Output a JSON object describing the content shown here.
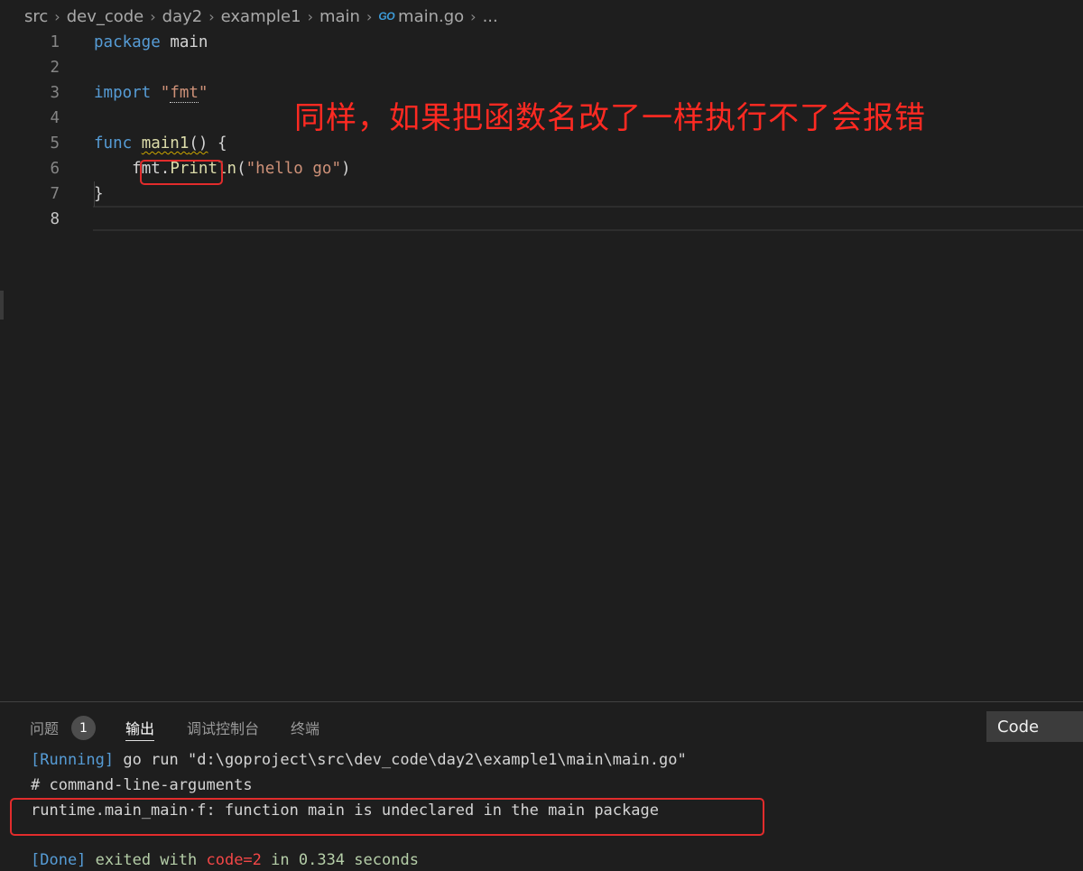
{
  "breadcrumb": {
    "items": [
      "src",
      "dev_code",
      "day2",
      "example1",
      "main"
    ],
    "file_icon": "go-icon",
    "file_icon_text": "GO",
    "file": "main.go",
    "trailing": "...",
    "separator": "›"
  },
  "editor": {
    "line_numbers": [
      "1",
      "2",
      "3",
      "4",
      "5",
      "6",
      "7",
      "8"
    ],
    "line1": {
      "kw": "package",
      "name": "main"
    },
    "line3": {
      "kw": "import",
      "q1": "\"",
      "pkg": "fmt",
      "q2": "\""
    },
    "line5": {
      "kw": "func",
      "name": "main1",
      "parens": "()",
      "brace": " {"
    },
    "line6": {
      "indent": "    ",
      "obj": "fmt",
      "dot": ".",
      "method": "Println",
      "open": "(",
      "str": "\"hello go\"",
      "close": ")"
    },
    "line7": {
      "brace": "}"
    }
  },
  "annotation": {
    "text": "同样，如果把函数名改了一样执行不了会报错",
    "color": "#ff2a22"
  },
  "panel": {
    "tabs": [
      {
        "label": "问题"
      },
      {
        "label": "输出"
      },
      {
        "label": "调试控制台"
      },
      {
        "label": "终端"
      }
    ],
    "problems_count": "1",
    "active_tab": "输出",
    "channel": "Code",
    "output": {
      "running_tag": "[Running]",
      "running_cmd": " go run \"d:\\goproject\\src\\dev_code\\day2\\example1\\main\\main.go\"",
      "line2": "# command-line-arguments",
      "line3": "runtime.main_main·f: function main is undeclared in the main package",
      "done_tag": "[Done]",
      "done_a": " exited with ",
      "done_code": "code=2",
      "done_b": " in ",
      "done_time": "0.334",
      "done_c": " seconds"
    }
  },
  "colors": {
    "keyword": "#569cd6",
    "string": "#ce9178",
    "function": "#dcdcaa",
    "error_box": "#e22c2c"
  }
}
